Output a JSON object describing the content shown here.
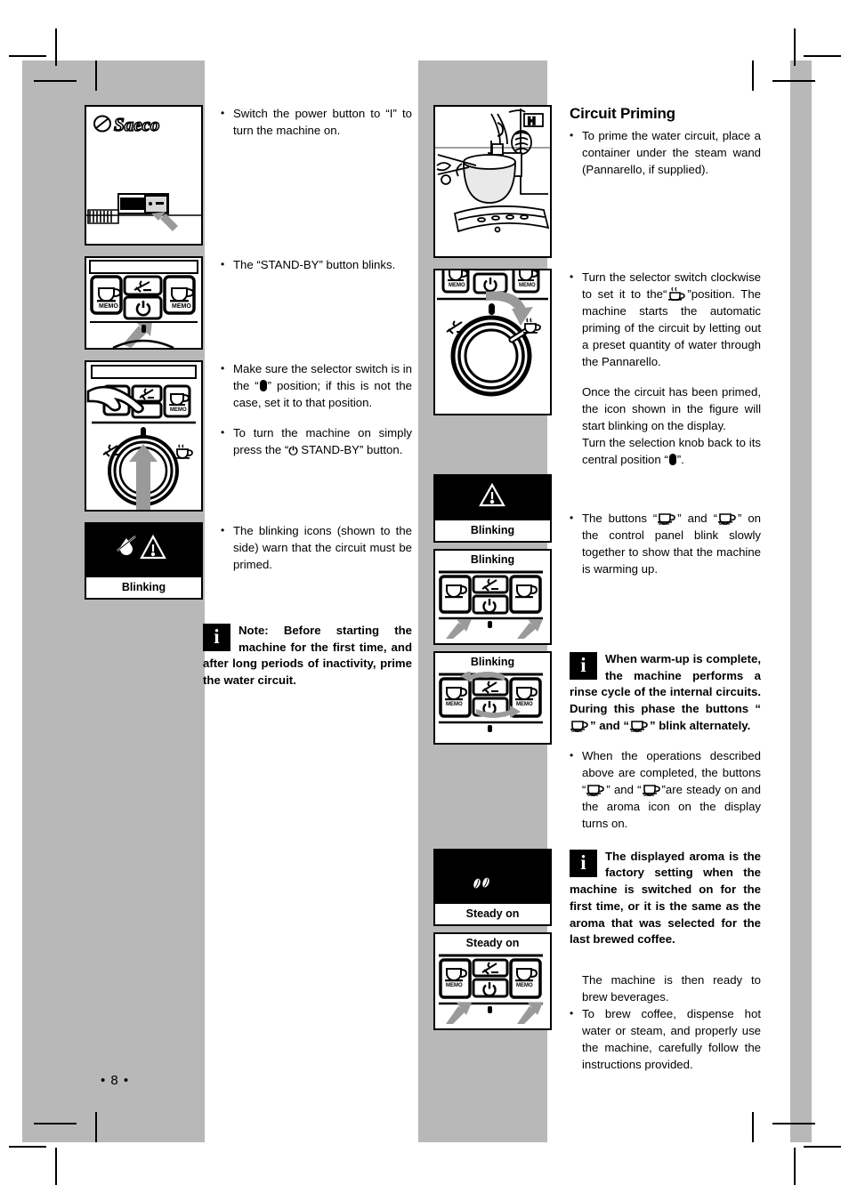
{
  "page": {
    "number": "• 8 •"
  },
  "left_column": {
    "steps": [
      {
        "bullet": "•",
        "text": "Switch the power button to “I” to turn the machine on."
      },
      {
        "bullet": "•",
        "text": "The “STAND-BY” button blinks."
      },
      {
        "bullet": "•",
        "text_before": "Make sure the selector switch is in the “",
        "text_after": "” position; if this is not the case, set it to that position."
      },
      {
        "bullet": "•",
        "text_before": "To turn the machine on simply press the “",
        "power_symbol": "⏻",
        "text_after": " STAND-BY” button."
      },
      {
        "bullet": "•",
        "text": "The blinking icons (shown to the side) warn that the circuit must be primed."
      }
    ],
    "note": {
      "icon": "info-icon",
      "icon_char": "i",
      "text": "Note: Before starting the machine for the first time, and after long periods of inactivity, prime the water circuit."
    },
    "figures": {
      "fig1_caption": "Saeco",
      "fig4_label": "Blinking"
    }
  },
  "right_column": {
    "heading": "Circuit Priming",
    "steps": [
      {
        "bullet": "•",
        "text": "To prime the water circuit, place a container under the steam wand (Pannarello, if supplied)."
      },
      {
        "bullet": "•",
        "text_before": "Turn the selector switch clockwise to set it to the“",
        "text_after": "”position. The machine starts the automatic priming of the circuit by letting out a preset quantity of water through the Pannarello."
      }
    ],
    "paragraphs": [
      "Once the circuit has been primed, the icon shown in the figure will start blinking on the display.",
      "Turn the selection knob back to its central position “"
    ],
    "para2_after": "”.",
    "step_warming": {
      "bullet": "•",
      "before": "The buttons “",
      "middle": "” and  “",
      "after": "” on the control panel blink slowly together to show that the machine is warming up."
    },
    "note1": {
      "icon": "info-icon",
      "icon_char": "i",
      "part1": "When warm-up is complete, the machine performs a rinse cycle of the internal circuits.",
      "part2": "During this phase the buttons “",
      "part3": "” and “",
      "part4": "” blink alternately."
    },
    "step_steady": {
      "bullet": "•",
      "before": "When the operations described above are completed, the buttons “",
      "middle": "” and “",
      "after": "”are steady on and the aroma icon on the display turns on."
    },
    "note2": {
      "icon": "info-icon",
      "icon_char": "i",
      "text": "The displayed aroma is the factory setting when the machine is switched on for the first time, or it is the same as the aroma that was selected for the last brewed coffee."
    },
    "closing_paragraph": "The machine is then ready to brew beverages.",
    "final_step": {
      "bullet": "•",
      "text": "To brew coffee, dispense hot water or steam, and properly use the machine, carefully follow the instructions provided."
    },
    "figure_labels": {
      "blinking_warning": "Blinking",
      "blinking_buttons": "Blinking",
      "blinking_alternate": "Blinking",
      "steady_display": "Steady on",
      "steady_buttons": "Steady on"
    }
  },
  "colors": {
    "band_gray": "#b8b8b8",
    "arrow_gray": "#9a9a9a",
    "ink": "#000000",
    "paper": "#ffffff"
  }
}
